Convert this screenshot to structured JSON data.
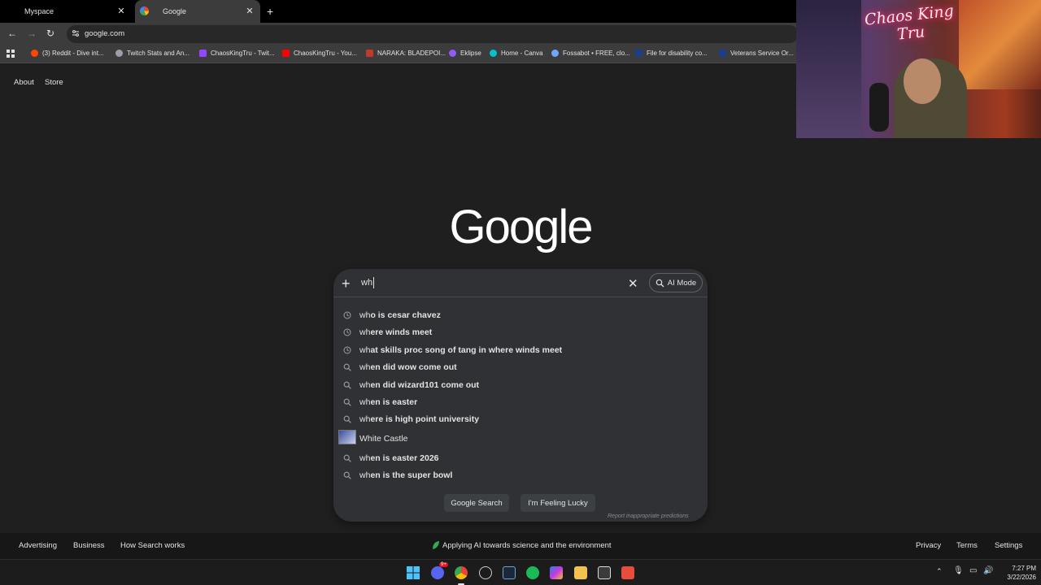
{
  "tabs": [
    {
      "label": "Myspace"
    },
    {
      "label": "Google"
    }
  ],
  "toolbar": {
    "url": "google.com"
  },
  "bookmarks": [
    {
      "label": "(3) Reddit - Dive int...",
      "color": "#ff4500"
    },
    {
      "label": "Twitch Stats and An...",
      "color": "#9aa0a6"
    },
    {
      "label": "ChaosKingTru - Twit...",
      "color": "#9146ff"
    },
    {
      "label": "ChaosKingTru - You...",
      "color": "#ff0000"
    },
    {
      "label": "NARAKA: BLADEPOI...",
      "color": "#c0392b"
    },
    {
      "label": "Eklipse",
      "color": "#8e5cf7"
    },
    {
      "label": "Home - Canva",
      "color": "#00c4cc"
    },
    {
      "label": "Fossabot • FREE, clo...",
      "color": "#6ea8fe"
    },
    {
      "label": "File for disability co...",
      "color": "#1d3f8a"
    },
    {
      "label": "Veterans Service Or...",
      "color": "#1d3f8a"
    }
  ],
  "header_links": {
    "about": "About",
    "store": "Store"
  },
  "logo": "Google",
  "search": {
    "query": "wh",
    "ai_mode": "AI Mode",
    "suggestions": [
      {
        "prefix": "wh",
        "rest": "o is cesar chavez",
        "type": "history"
      },
      {
        "prefix": "wh",
        "rest": "ere winds meet",
        "type": "history"
      },
      {
        "prefix": "wh",
        "rest": "at skills proc song of tang in where winds meet",
        "type": "history"
      },
      {
        "prefix": "wh",
        "rest": "en did wow come out",
        "type": "search"
      },
      {
        "prefix": "wh",
        "rest": "en did wizard101 come out",
        "type": "search"
      },
      {
        "prefix": "wh",
        "rest": "en is easter",
        "type": "search"
      },
      {
        "prefix": "wh",
        "rest": "ere is high point university",
        "type": "search"
      },
      {
        "prefix": "",
        "rest": "White Castle",
        "type": "entity"
      },
      {
        "prefix": "wh",
        "rest": "en is easter 2026",
        "type": "search"
      },
      {
        "prefix": "wh",
        "rest": "en is the super bowl",
        "type": "search"
      }
    ],
    "google_search": "Google Search",
    "feeling_lucky": "I'm Feeling Lucky",
    "report": "Report inappropriate predictions"
  },
  "footer": {
    "advertising": "Advertising",
    "business": "Business",
    "how_search_works": "How Search works",
    "center": "Applying AI towards science and the environment",
    "privacy": "Privacy",
    "terms": "Terms",
    "settings": "Settings"
  },
  "taskbar": {
    "time": "7:27 PM",
    "date": "3/22/2026",
    "discord_badge": "9+"
  },
  "webcam": {
    "neon_sign": "Chaos King Tru"
  }
}
